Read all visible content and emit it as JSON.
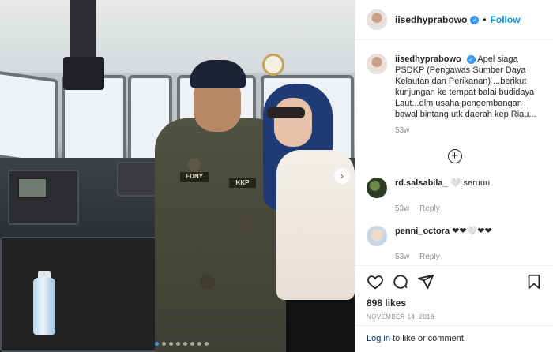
{
  "post": {
    "author": "iisedhyprabowo",
    "follow_label": "Follow",
    "separator": "•",
    "caption": "Apel siaga PSDKP (Pengawas Sumber Daya Kelautan dan Perikanan) ...berikut kunjungan ke tempat balai budidaya Laut...dlm usaha pengembangan bawal bintang utk daerah kep Riau...",
    "caption_time": "53w",
    "likes": "898 likes",
    "date": "NOVEMBER 14, 2019",
    "photo_labels": {
      "name_tag": "EDNY",
      "agency_tag": "KKP"
    },
    "carousel": {
      "count": 8,
      "active_index": 0
    }
  },
  "comments": [
    {
      "user": "rd.salsabila_",
      "text": "🤍 seruuu",
      "time": "53w",
      "reply_label": "Reply"
    },
    {
      "user": "penni_octora",
      "text": "❤❤🤍❤❤",
      "time": "53w",
      "reply_label": "Reply"
    }
  ],
  "footer": {
    "login_link": "Log in",
    "login_suffix": " to like or comment."
  },
  "icons": {
    "verified": "verified-badge-icon",
    "more": "plus-circle-icon",
    "like": "heart-icon",
    "comment": "comment-bubble-icon",
    "share": "paper-plane-icon",
    "save": "bookmark-icon",
    "next": "chevron-right-icon"
  },
  "colors": {
    "accent": "#0095f6",
    "verified": "#3897f0",
    "muted": "#8e8e8e",
    "text": "#262626"
  }
}
